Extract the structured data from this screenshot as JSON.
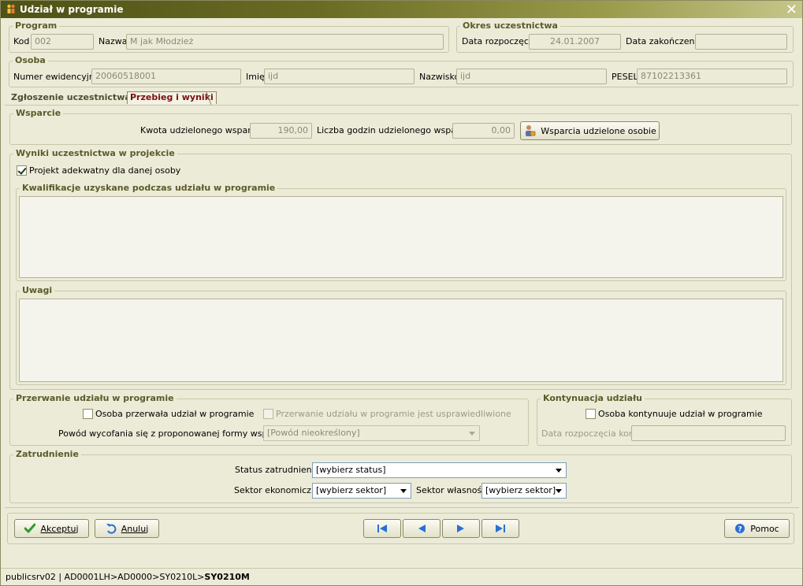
{
  "window": {
    "title": "Udział w programie"
  },
  "program": {
    "legend": "Program",
    "kod_label": "Kod",
    "kod_value": "002",
    "nazwa_label": "Nazwa",
    "nazwa_value": "M jak Młodzież"
  },
  "okres": {
    "legend": "Okres uczestnictwa",
    "start_label": "Data rozpoczęcia",
    "start_value": "24.01.2007",
    "end_label": "Data zakończenia",
    "end_value": ""
  },
  "osoba": {
    "legend": "Osoba",
    "numer_label": "Numer ewidencyjny",
    "numer_value": "20060518001",
    "imie_label": "Imię",
    "imie_value": "ijd",
    "nazwisko_label": "Nazwisko",
    "nazwisko_value": "ijd",
    "pesel_label": "PESEL",
    "pesel_value": "87102213361"
  },
  "tabs": [
    {
      "label": "Zgłoszenie uczestnictwa"
    },
    {
      "label": "Przebieg i wyniki"
    }
  ],
  "wsparcie": {
    "legend": "Wsparcie",
    "kwota_label": "Kwota udzielonego wsparcia",
    "kwota_value": "190,00",
    "godziny_label": "Liczba godzin udzielonego wsparcia",
    "godziny_value": "0,00",
    "button_label": "Wsparcia udzielone osobie"
  },
  "wyniki": {
    "legend": "Wyniki uczestnictwa w projekcie",
    "adekwatny_label": "Projekt adekwatny dla danej osoby",
    "adekwatny_checked": true,
    "kwalifikacje_legend": "Kwalifikacje uzyskane podczas udziału w programie",
    "kwalifikacje_value": "",
    "uwagi_legend": "Uwagi",
    "uwagi_value": ""
  },
  "przerwanie": {
    "legend": "Przerwanie udziału w programie",
    "przerwala_label": "Osoba przerwała udział w programie",
    "usprawiedliwione_label": "Przerwanie udziału w programie jest usprawiedliwione",
    "powod_label": "Powód wycofania się z proponowanej formy wsparcia",
    "powod_value": "[Powód nieokreślony]"
  },
  "kontynuacja": {
    "legend": "Kontynuacja udziału",
    "kontynuuje_label": "Osoba kontynuuje udział w programie",
    "data_label": "Data rozpoczęcia kont.",
    "data_value": ""
  },
  "zatrudnienie": {
    "legend": "Zatrudnienie",
    "status_label": "Status zatrudnienia",
    "status_value": "[wybierz status]",
    "sektor_ek_label": "Sektor ekonomiczny",
    "sektor_ek_value": "[wybierz sektor]",
    "sektor_wl_label": "Sektor własności",
    "sektor_wl_value": "[wybierz sektor]"
  },
  "buttons": {
    "accept_label": "Akceptuj",
    "cancel_label": "Anuluj",
    "help_label": "Pomoc"
  },
  "status": {
    "path": "publicsrv02 | AD0001LH>AD0000>SY0210L>",
    "current": "SY0210M"
  },
  "colors": {
    "accent": "#5b5a2a",
    "active_tab": "#7a1010",
    "accept_icon": "#2e9a2e",
    "nav_icon": "#2a6fd6"
  }
}
